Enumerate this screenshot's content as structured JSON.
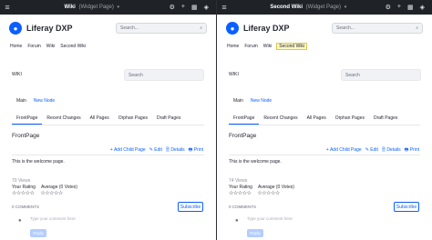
{
  "panes": [
    {
      "topbar": {
        "menu_icon": "≡",
        "title": "Wiki",
        "subtitle": "(Widget Page)",
        "dropdown": "▾",
        "icons": [
          "settings-icon",
          "plus-icon",
          "grid-icon",
          "compass-icon"
        ]
      },
      "site": {
        "logo_icon": "liferay-logo",
        "name": "Liferay DXP",
        "search_placeholder": "Search..."
      },
      "nav": [
        "Home",
        "Forum",
        "Wiki",
        "Second Wiki"
      ],
      "nav_active_index": -1,
      "portlet": {
        "title": "WIKI",
        "search_placeholder": "Search"
      },
      "navbar": {
        "main": "Main",
        "new_node": "New Node"
      },
      "tabs": [
        "FrontPage",
        "Recent Changes",
        "All Pages",
        "Orphan Pages",
        "Draft Pages"
      ],
      "tab_active_index": 0,
      "page_title": "FrontPage",
      "actions": [
        "+ Add Child Page",
        "✎ Edit",
        "🗎 Details",
        "🖶 Print"
      ],
      "body": "This is the welcome page.",
      "views": "70 Views",
      "rating": {
        "your": "Your Rating",
        "average": "Average (0 Votes)",
        "your_stars": "☆☆☆☆☆",
        "avg_stars": "☆☆☆☆☆"
      },
      "comments": {
        "count": "0 COMMENTS",
        "subscribe": "Subscribe",
        "placeholder": "Type your comment here",
        "reply": "Reply"
      }
    },
    {
      "topbar": {
        "menu_icon": "≡",
        "title": "Second Wiki",
        "subtitle": "(Widget Page)",
        "dropdown": "▾",
        "icons": [
          "settings-icon",
          "plus-icon",
          "grid-icon",
          "compass-icon"
        ]
      },
      "site": {
        "logo_icon": "liferay-logo",
        "name": "Liferay DXP",
        "search_placeholder": "Search..."
      },
      "nav": [
        "Home",
        "Forum",
        "Wiki",
        "Second Wiki"
      ],
      "nav_active_index": 3,
      "portlet": {
        "title": "WIKI",
        "search_placeholder": "Search"
      },
      "navbar": {
        "main": "Main",
        "new_node": "New Node"
      },
      "tabs": [
        "FrontPage",
        "Recent Changes",
        "All Pages",
        "Orphan Pages",
        "Draft Pages"
      ],
      "tab_active_index": 0,
      "page_title": "FrontPage",
      "actions": [
        "+ Add Child Page",
        "✎ Edit",
        "🗎 Details",
        "🖶 Print"
      ],
      "body": "This is the welcome page.",
      "views": "74 Views",
      "rating": {
        "your": "Your Rating",
        "average": "Average (0 Votes)",
        "your_stars": "☆☆☆☆☆",
        "avg_stars": "☆☆☆☆☆"
      },
      "comments": {
        "count": "0 COMMENTS",
        "subscribe": "Subscribe",
        "placeholder": "Type your comment here",
        "reply": "Reply"
      }
    }
  ]
}
